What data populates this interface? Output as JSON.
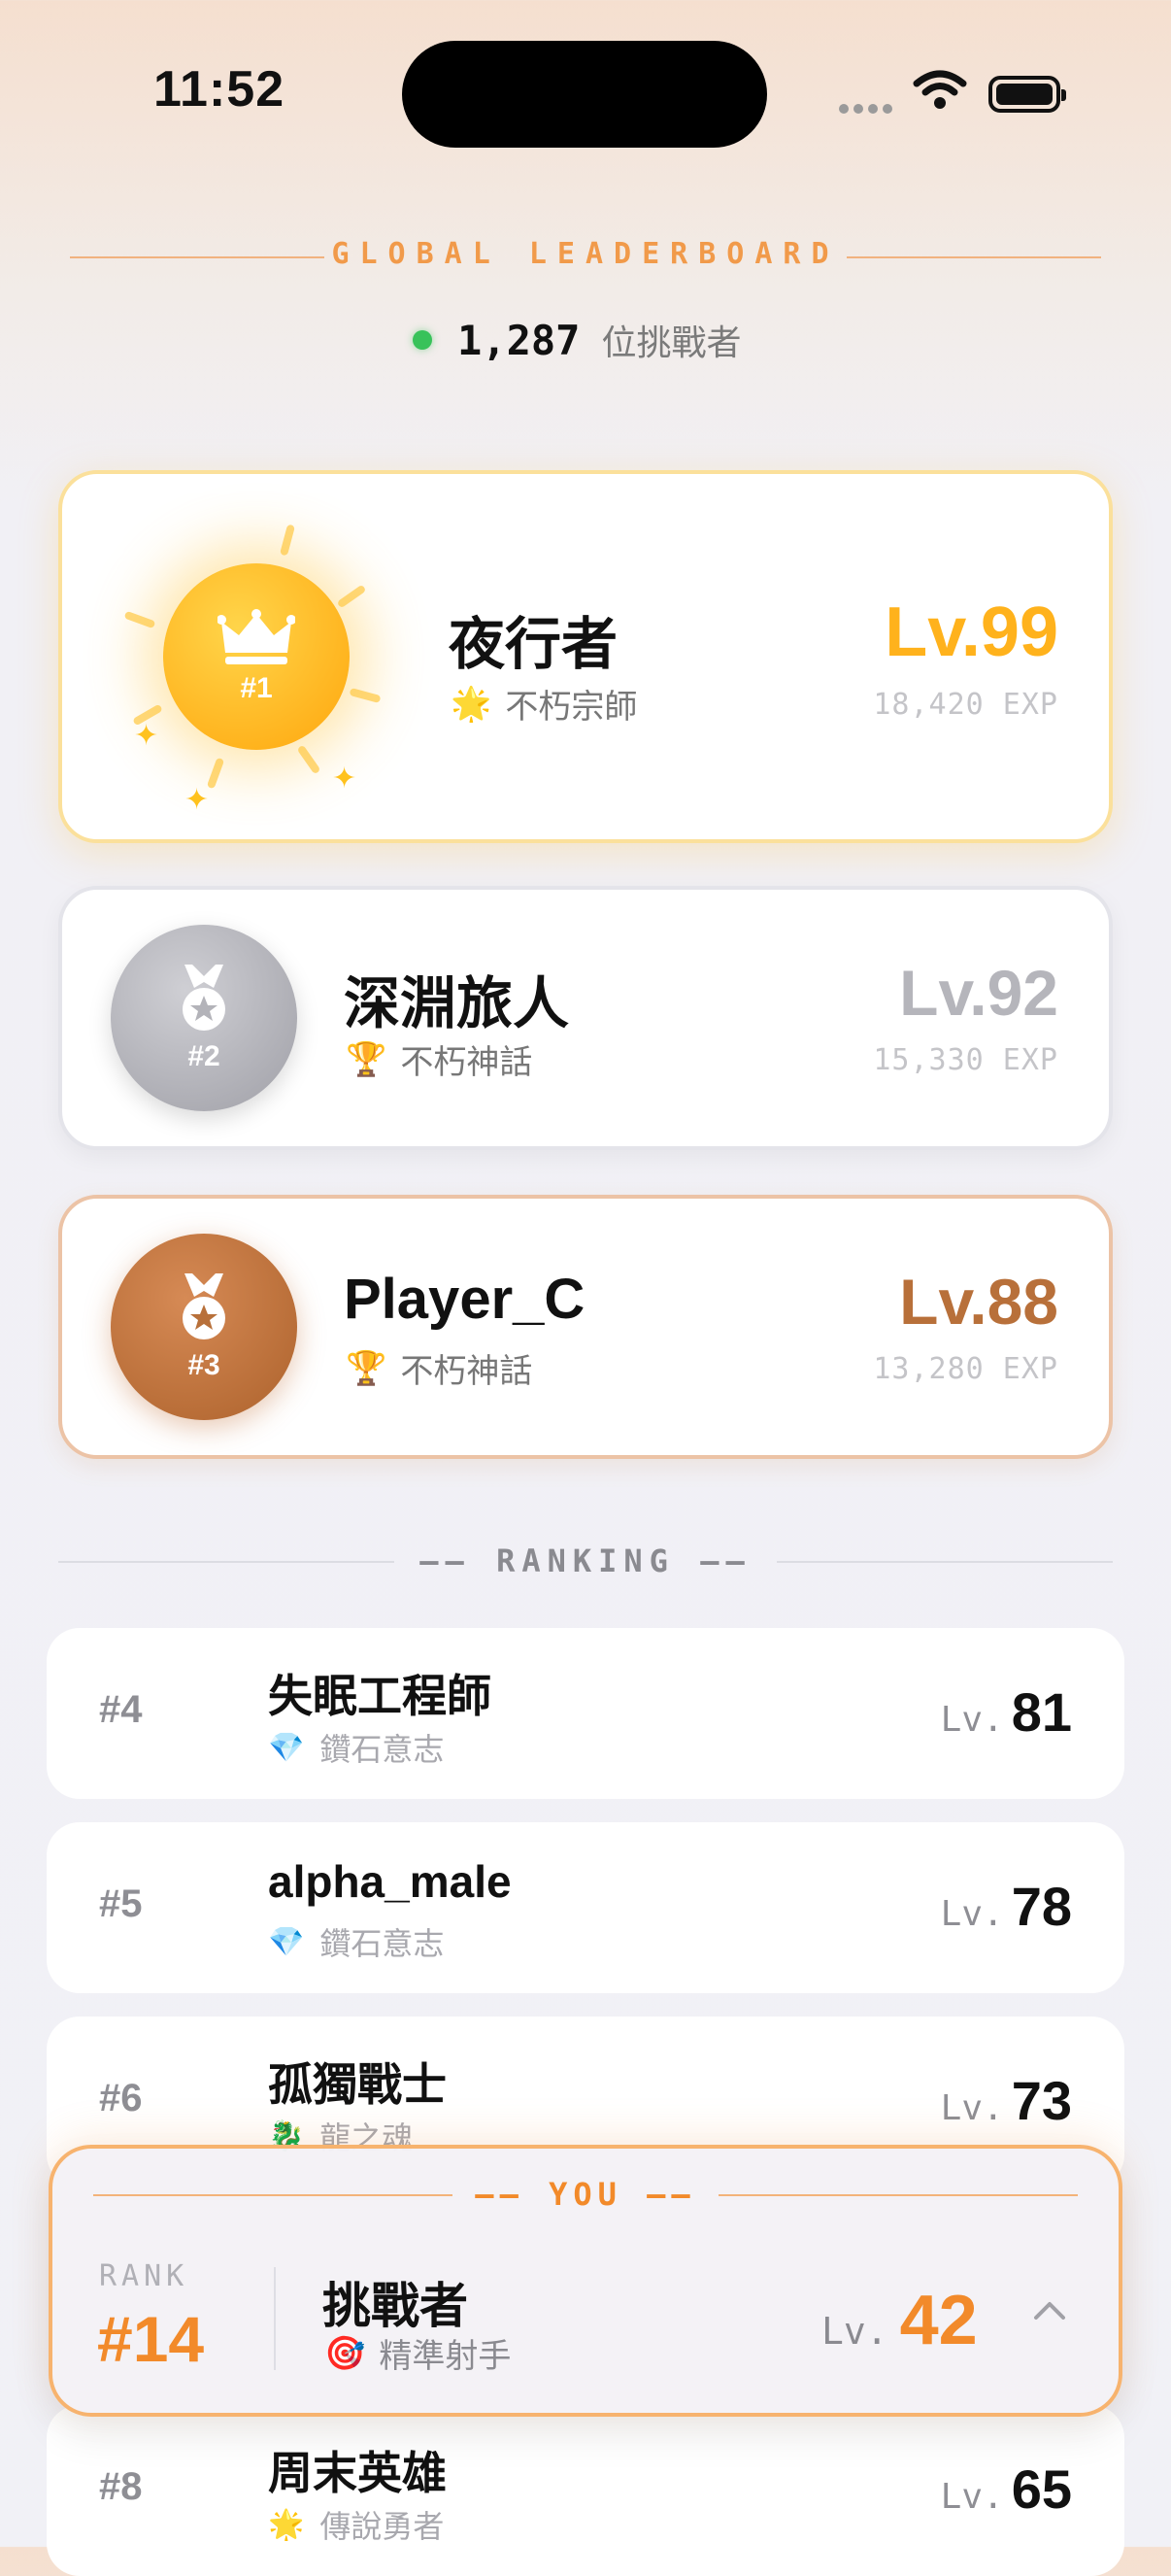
{
  "status_bar": {
    "time": "11:52"
  },
  "header": {
    "title": "GLOBAL LEADERBOARD",
    "online_count": "1,287",
    "online_label": "位挑戰者"
  },
  "podium": [
    {
      "rank": "#1",
      "name": "夜行者",
      "title_icon": "🌟",
      "title": "不朽宗師",
      "level": "Lv.99",
      "exp": "18,420 EXP",
      "accent": "#ffb21c"
    },
    {
      "rank": "#2",
      "name": "深淵旅人",
      "title_icon": "🏆",
      "title": "不朽神話",
      "level": "Lv.92",
      "exp": "15,330 EXP",
      "accent": "#b5b5bb"
    },
    {
      "rank": "#3",
      "name": "Player_C",
      "title_icon": "🏆",
      "title": "不朽神話",
      "level": "Lv.88",
      "exp": "13,280 EXP",
      "accent": "#b8703a"
    }
  ],
  "ranking": {
    "label": "—— RANKING ——",
    "rows": [
      {
        "rank": "#4",
        "name": "失眠工程師",
        "title_icon": "💎",
        "title": "鑽石意志",
        "level_prefix": "Lv.",
        "level": "81"
      },
      {
        "rank": "#5",
        "name": "alpha_male",
        "title_icon": "💎",
        "title": "鑽石意志",
        "level_prefix": "Lv.",
        "level": "78"
      },
      {
        "rank": "#6",
        "name": "孤獨戰士",
        "title_icon": "🐉",
        "title": "龍之魂",
        "level_prefix": "Lv.",
        "level": "73"
      },
      {
        "rank": "#8",
        "name": "周末英雄",
        "title_icon": "🌟",
        "title": "傳說勇者",
        "level_prefix": "Lv.",
        "level": "65"
      }
    ]
  },
  "you": {
    "label": "—— YOU ——",
    "rank_label": "RANK",
    "rank": "#14",
    "name": "挑戰者",
    "title_icon": "🎯",
    "title": "精準射手",
    "level_prefix": "Lv.",
    "level": "42"
  },
  "colors": {
    "accent_orange": "#f28a2a",
    "gold": "#ffb21c",
    "online_dot": "#38c25a"
  }
}
